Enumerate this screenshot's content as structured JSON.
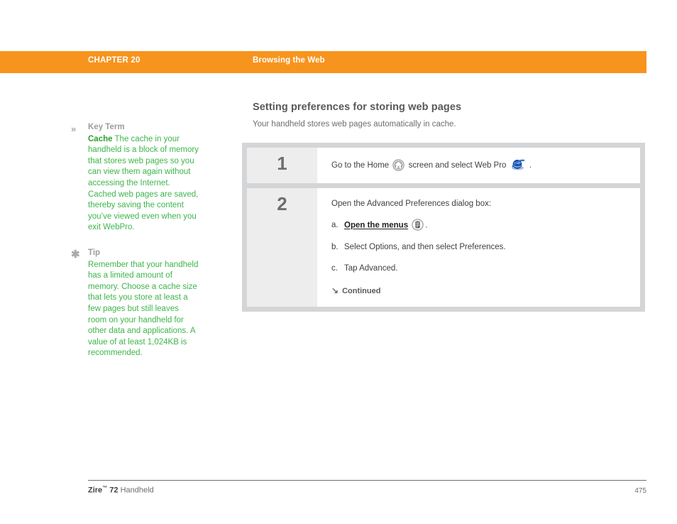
{
  "header": {
    "chapter": "CHAPTER 20",
    "title": "Browsing the Web",
    "bar_color": "#f7941e"
  },
  "sidebar": {
    "notes": [
      {
        "icon": "chevron-double-right-icon",
        "glyph": "»",
        "label": "Key Term",
        "term": "Cache",
        "text": "The cache in your handheld is a block of memory that stores web pages so you can view them again without accessing the Internet. Cached web pages are saved, thereby saving the content you’ve viewed even when you exit WebPro."
      },
      {
        "icon": "asterisk-icon",
        "glyph": "✱",
        "label": "Tip",
        "term": "",
        "text": "Remember that your handheld has a limited amount of memory. Choose a cache size that lets you store at least a few pages but still leaves room on your handheld for other data and applications. A value of at least 1,024KB is recommended."
      }
    ],
    "text_color": "#3db54a",
    "label_color": "#9b9d9f"
  },
  "main": {
    "heading": "Setting preferences for storing web pages",
    "subtitle": "Your handheld stores web pages automatically in cache."
  },
  "steps": [
    {
      "number": "1",
      "text_before": "Go to the Home",
      "text_middle": "screen and select Web Pro",
      "text_after": ".",
      "icon_home": "home-icon",
      "icon_globe": "web-pro-globe-icon"
    },
    {
      "number": "2",
      "intro": "Open the Advanced Preferences dialog box:",
      "substeps": [
        {
          "marker": "a.",
          "emphasis": "Open the menus",
          "icon": "menu-icon",
          "suffix": "."
        },
        {
          "marker": "b.",
          "emphasis": "",
          "icon": "",
          "suffix": "Select Options, and then select Preferences."
        },
        {
          "marker": "c.",
          "emphasis": "",
          "icon": "",
          "suffix": "Tap Advanced."
        }
      ],
      "continued_arrow": "↘",
      "continued_label": "Continued"
    }
  ],
  "footer": {
    "brand": "Zire",
    "tm": "™",
    "model": "72",
    "product": "Handheld",
    "page_number": "475"
  }
}
